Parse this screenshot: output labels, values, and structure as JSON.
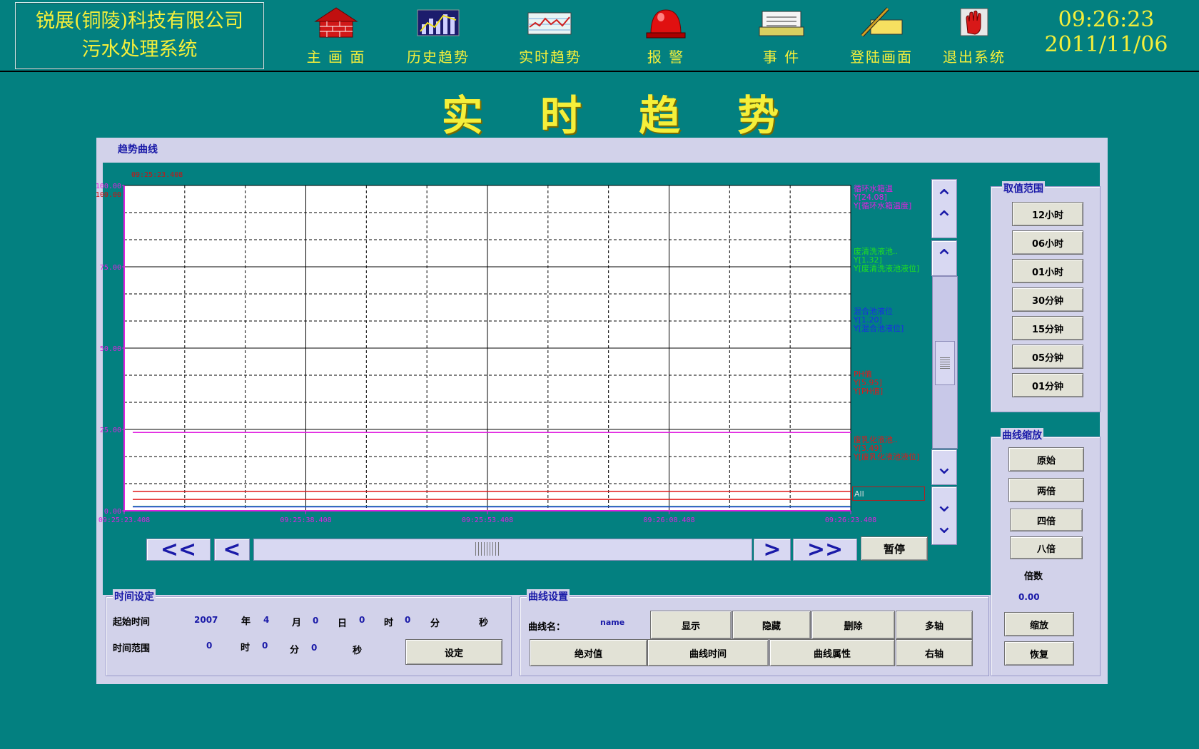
{
  "header": {
    "company_line1": "锐展(铜陵)科技有限公司",
    "company_line2": "污水处理系统",
    "nav": [
      {
        "label": "主 画 面",
        "icon": "house-icon"
      },
      {
        "label": "历史趋势",
        "icon": "bar-chart-icon"
      },
      {
        "label": "实时趋势",
        "icon": "line-chart-icon"
      },
      {
        "label": "报   警",
        "icon": "alarm-light-icon"
      },
      {
        "label": "事  件",
        "icon": "printer-icon"
      },
      {
        "label": "登陆画面",
        "icon": "pen-hand-icon"
      },
      {
        "label": "退出系统",
        "icon": "stop-hand-icon"
      }
    ],
    "time": "09:26:23",
    "date": "2011/11/06"
  },
  "page_title": "实 时 趋 势",
  "panel": {
    "tab_label": "趋势曲线"
  },
  "chart_data": {
    "type": "line",
    "top_time_label": "09:25:23.408",
    "y_ticks": [
      "100.00",
      "75.00",
      "50.00",
      "25.00",
      "0.00"
    ],
    "y_ticks_left": "100.00",
    "x_ticks": [
      "09:25:23.408",
      "09:25:38.408",
      "09:25:53.408",
      "09:26:08.408",
      "09:26:23.408"
    ],
    "ylim": [
      0,
      100
    ],
    "series": [
      {
        "name": "循环水箱温",
        "y_value": "Y[24.08]",
        "tag": "Y[循环水箱温度]",
        "color": "#e020e0",
        "value": 24.08
      },
      {
        "name": "废清洗液池..",
        "y_value": "Y[1.32]",
        "tag": "Y[废清洗液池液位]",
        "color": "#20e020",
        "value": 1.32
      },
      {
        "name": "混合池液位",
        "y_value": "Y[1.20]",
        "tag": "Y[混合池液位]",
        "color": "#1a2ae8",
        "value": 1.2
      },
      {
        "name": "PH值",
        "y_value": "Y[5.95]",
        "tag": "Y[PH值]",
        "color": "#e01818",
        "value": 5.95
      },
      {
        "name": "废乳化液池..",
        "y_value": "Y[3.49]",
        "tag": "Y[废乳化液池液位]",
        "color": "#e01818",
        "value": 3.49
      }
    ],
    "filter_box": "All"
  },
  "controls": {
    "pause": "暂停",
    "hscroll_left_fast": "<<",
    "hscroll_left": "<",
    "hscroll_right": ">",
    "hscroll_right_fast": ">>"
  },
  "range_group": {
    "title": "取值范围",
    "buttons": [
      "12小时",
      "06小时",
      "01小时",
      "30分钟",
      "15分钟",
      "05分钟",
      "01分钟"
    ]
  },
  "zoom_group": {
    "title": "曲线缩放",
    "buttons": [
      "原始",
      "两倍",
      "四倍",
      "八倍"
    ],
    "factor_label": "倍数",
    "factor_value": "0.00",
    "zoom_button": "缩放",
    "restore_button": "恢复"
  },
  "time_group": {
    "title": "时间设定",
    "start_label": "起始时间",
    "year": "2007",
    "year_unit": "年",
    "month": "4",
    "month_unit": "月",
    "day": "0",
    "day_unit": "日",
    "hour": "0",
    "hour_unit": "时",
    "minute": "0",
    "minute_unit": "分",
    "second_unit": "秒",
    "range_label": "时间范围",
    "r_hour": "0",
    "r_hour_unit": "时",
    "r_min": "0",
    "r_min_unit": "分",
    "r_sec": "0",
    "r_sec_unit": "秒",
    "set_button": "设定"
  },
  "curve_group": {
    "title": "曲线设置",
    "name_label": "曲线名：",
    "name_value": "name",
    "buttons_row1": [
      "显示",
      "隐藏",
      "删除",
      "多轴"
    ],
    "buttons_row2": [
      "绝对值",
      "曲线时间",
      "曲线属性",
      "右轴"
    ]
  }
}
